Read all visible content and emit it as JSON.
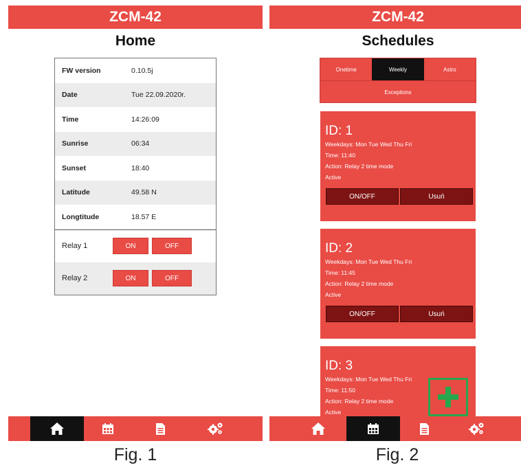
{
  "screen1": {
    "appbar_title": "ZCM-42",
    "page_title": "Home",
    "info": [
      {
        "label": "FW version",
        "value": "0.10.5j"
      },
      {
        "label": "Date",
        "value": "Tue 22.09.2020r."
      },
      {
        "label": "Time",
        "value": "14:26:09"
      },
      {
        "label": "Sunrise",
        "value": "06:34"
      },
      {
        "label": "Sunset",
        "value": "18:40"
      },
      {
        "label": "Latitude",
        "value": "49.58 N"
      },
      {
        "label": "Longtitude",
        "value": "18.57 E"
      }
    ],
    "relays": [
      {
        "label": "Relay 1",
        "on": "ON",
        "off": "OFF"
      },
      {
        "label": "Relay 2",
        "on": "ON",
        "off": "OFF"
      }
    ],
    "active_nav": "home",
    "caption": "Fig. 1"
  },
  "screen2": {
    "appbar_title": "ZCM-42",
    "page_title": "Schedules",
    "tabs": [
      "Onetime",
      "Weekly",
      "Astro"
    ],
    "active_tab": "Weekly",
    "exceptions_tab": "Exceptions",
    "schedules": [
      {
        "id": "ID: 1",
        "weekdays": "Weekdays: Mon Tue Wed Thu Fri",
        "time": "Time: 11:40",
        "action": "Action: Relay 2 time mode",
        "status": "Active",
        "toggle": "ON/OFF",
        "delete": "Usuń"
      },
      {
        "id": "ID: 2",
        "weekdays": "Weekdays: Mon Tue Wed Thu Fri",
        "time": "Time: 11:45",
        "action": "Action: Relay 2 time mode",
        "status": "Active",
        "toggle": "ON/OFF",
        "delete": "Usuń"
      },
      {
        "id": "ID: 3",
        "weekdays": "Weekdays: Mon Tue Wed Thu Fri",
        "time": "Time: 11:50",
        "action": "Action: Relay 2 time mode",
        "status": "Active"
      }
    ],
    "active_nav": "schedules",
    "caption": "Fig. 2"
  },
  "nav_icons": [
    "home-icon",
    "calendar-icon",
    "document-icon",
    "settings-icon"
  ],
  "colors": {
    "primary": "#e94b45",
    "active": "#111111",
    "dark_button": "#7d1313",
    "fab_border": "#27a74e"
  }
}
